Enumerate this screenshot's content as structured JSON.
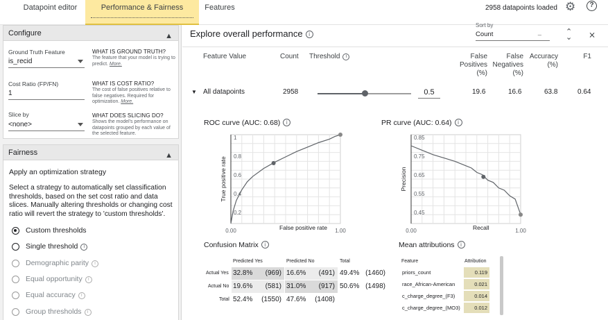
{
  "tabs": [
    {
      "label": "Datapoint editor"
    },
    {
      "label": "Performance & Fairness"
    },
    {
      "label": "Features"
    }
  ],
  "header": {
    "datapoints_loaded": "2958 datapoints loaded"
  },
  "configure": {
    "title": "Configure",
    "ground_truth": {
      "label": "Ground Truth Feature",
      "value": "is_recid",
      "help_title": "WHAT IS GROUND TRUTH?",
      "help_body": "The feature that your model is trying to predict.",
      "more": "More."
    },
    "cost_ratio": {
      "label": "Cost Ratio (FP/FN)",
      "value": "1",
      "help_title": "WHAT IS COST RATIO?",
      "help_body": "The cost of false positives relative to false negatives. Required for optimization.",
      "more": "More."
    },
    "slice_by": {
      "label": "Slice by",
      "value": "<none>",
      "help_title": "WHAT DOES SLICING DO?",
      "help_body": "Shows the model's performance on datapoints grouped by each value of the selected feature."
    }
  },
  "fairness": {
    "title": "Fairness",
    "heading": "Apply an optimization strategy",
    "paragraph": "Select a strategy to automatically set classification thresholds, based on the set cost ratio and data slices. Manually altering thresholds or changing cost ratio will revert the strategy to 'custom thresholds'.",
    "options": [
      {
        "label": "Custom thresholds",
        "selected": true,
        "enabled": true
      },
      {
        "label": "Single threshold",
        "selected": false,
        "enabled": true
      },
      {
        "label": "Demographic parity",
        "selected": false,
        "enabled": false
      },
      {
        "label": "Equal opportunity",
        "selected": false,
        "enabled": false
      },
      {
        "label": "Equal accuracy",
        "selected": false,
        "enabled": false
      },
      {
        "label": "Group thresholds",
        "selected": false,
        "enabled": false
      }
    ]
  },
  "performance": {
    "title": "Explore overall performance",
    "sort_by_label": "Sort by",
    "sort_by_value": "Count",
    "columns": {
      "feature_value": "Feature Value",
      "count": "Count",
      "threshold": "Threshold",
      "false_positives": "False Positives (%)",
      "false_negatives": "False Negatives (%)",
      "accuracy": "Accuracy (%)",
      "f1": "F1"
    },
    "row": {
      "name": "All datapoints",
      "count": "2958",
      "threshold": "0.5",
      "threshold_value": 0.5,
      "false_positives": "19.6",
      "false_negatives": "16.6",
      "accuracy": "63.8",
      "f1": "0.64"
    }
  },
  "roc": {
    "title": "ROC curve (AUC: 0.68)",
    "xlabel": "False positive rate",
    "ylabel": "True positive rate",
    "xticks": [
      "0.00",
      "1.00"
    ],
    "yticks": [
      "1",
      "0.8",
      "0.6",
      "0.4",
      "0.2"
    ]
  },
  "pr": {
    "title": "PR curve (AUC: 0.64)",
    "xlabel": "Recall",
    "ylabel": "Precision",
    "xticks": [
      "0.00",
      "1.00"
    ],
    "yticks": [
      "0.85",
      "0.75",
      "0.65",
      "0.55",
      "0.45"
    ]
  },
  "confusion": {
    "title": "Confusion Matrix",
    "col_headers": [
      "Predicted Yes",
      "Predicted No",
      "Total"
    ],
    "rows": [
      {
        "label": "Actual Yes",
        "cells": [
          {
            "pct": "32.8%",
            "n": "(969)"
          },
          {
            "pct": "16.6%",
            "n": "(491)"
          },
          {
            "pct": "49.4%",
            "n": "(1460)"
          }
        ]
      },
      {
        "label": "Actual No",
        "cells": [
          {
            "pct": "19.6%",
            "n": "(581)"
          },
          {
            "pct": "31.0%",
            "n": "(917)"
          },
          {
            "pct": "50.6%",
            "n": "(1498)"
          }
        ]
      },
      {
        "label": "Total",
        "cells": [
          {
            "pct": "52.4%",
            "n": "(1550)"
          },
          {
            "pct": "47.6%",
            "n": "(1408)"
          }
        ]
      }
    ]
  },
  "attributions": {
    "title": "Mean attributions",
    "col_feature": "Feature",
    "col_attribution": "Attribution",
    "rows": [
      {
        "feature": "priors_count",
        "value": "0.119"
      },
      {
        "feature": "race_African-American",
        "value": "0.021"
      },
      {
        "feature": "c_charge_degree_(F3)",
        "value": "0.014"
      },
      {
        "feature": "c_charge_degree_(MO3)",
        "value": "0.012"
      }
    ]
  },
  "chart_data": [
    {
      "type": "line",
      "title": "ROC curve (AUC: 0.68)",
      "xlabel": "False positive rate",
      "ylabel": "True positive rate",
      "xlim": [
        0,
        1
      ],
      "ylim": [
        0,
        1
      ],
      "x": [
        0,
        0.02,
        0.05,
        0.1,
        0.15,
        0.2,
        0.3,
        0.4,
        0.5,
        0.6,
        0.7,
        0.8,
        0.9,
        0.95,
        1.0
      ],
      "y": [
        0,
        0.14,
        0.26,
        0.38,
        0.47,
        0.53,
        0.62,
        0.69,
        0.75,
        0.81,
        0.86,
        0.91,
        0.95,
        0.98,
        1.0
      ],
      "marker": {
        "x": 0.39,
        "y": 0.68
      },
      "endpoint": {
        "x": 1.0,
        "y": 1.0
      },
      "grid": true
    },
    {
      "type": "line",
      "title": "PR curve (AUC: 0.64)",
      "xlabel": "Recall",
      "ylabel": "Precision",
      "xlim": [
        0,
        1
      ],
      "ylim": [
        0.45,
        0.85
      ],
      "x": [
        0,
        0.1,
        0.2,
        0.3,
        0.4,
        0.5,
        0.55,
        0.6,
        0.65,
        0.7,
        0.75,
        0.8,
        0.85,
        0.9,
        0.95,
        1.0
      ],
      "y": [
        0.8,
        0.78,
        0.76,
        0.745,
        0.73,
        0.71,
        0.7,
        0.68,
        0.67,
        0.645,
        0.635,
        0.61,
        0.6,
        0.575,
        0.56,
        0.49
      ],
      "marker": {
        "x": 0.66,
        "y": 0.66
      },
      "endpoint": {
        "x": 1.0,
        "y": 0.49
      },
      "grid": true
    }
  ]
}
